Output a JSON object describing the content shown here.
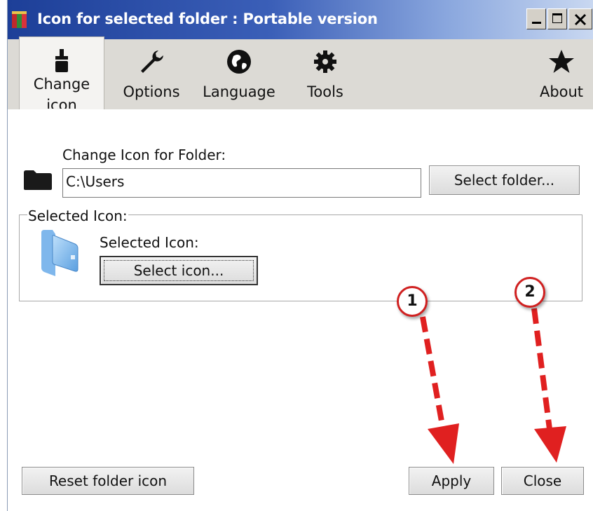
{
  "window": {
    "title": "Icon for selected folder : Portable version",
    "controls": {
      "minimize": "_",
      "maximize": "□",
      "close": "✕"
    }
  },
  "toolbar": {
    "items": [
      {
        "label": "Change icon",
        "icon": "brush-icon",
        "active": true
      },
      {
        "label": "Options",
        "icon": "wrench-icon"
      },
      {
        "label": "Language",
        "icon": "globe-icon"
      },
      {
        "label": "Tools",
        "icon": "gear-icon"
      },
      {
        "label": "About",
        "icon": "star-icon"
      }
    ]
  },
  "folder_section": {
    "label": "Change Icon for Folder:",
    "path_value": "C:\\Users",
    "select_folder_button": "Select folder..."
  },
  "icon_section": {
    "group_title": "Selected Icon:",
    "label": "Selected Icon:",
    "select_icon_button": "Select icon..."
  },
  "footer": {
    "reset_button": "Reset folder icon",
    "apply_button": "Apply",
    "close_button": "Close"
  },
  "annotations": {
    "callout_1": "1",
    "callout_2": "2",
    "color": "#e02020"
  }
}
